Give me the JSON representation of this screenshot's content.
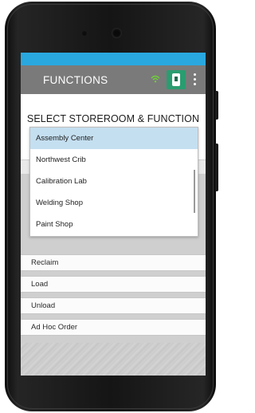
{
  "header": {
    "title": "FUNCTIONS",
    "icons": {
      "wifi": "wifi-icon",
      "app": "device-icon",
      "menu": "more-vert-icon"
    },
    "colors": {
      "status_bar": "#29a8e0",
      "app_bar": "#7a7a7a",
      "app_button": "#2a9d70"
    }
  },
  "main": {
    "section_title": "SELECT STOREROOM & FUNCTION",
    "storeroom_dropdown": {
      "options": [
        "Assembly Center",
        "Northwest Crib",
        "Calibration Lab",
        "Welding Shop",
        "Paint Shop"
      ],
      "selected": "Assembly Center",
      "selected_color": "#c4dff0"
    },
    "functions": [
      {
        "label": "Reclaim"
      },
      {
        "label": "Load"
      },
      {
        "label": "Unload"
      },
      {
        "label": "Ad Hoc Order"
      }
    ]
  }
}
